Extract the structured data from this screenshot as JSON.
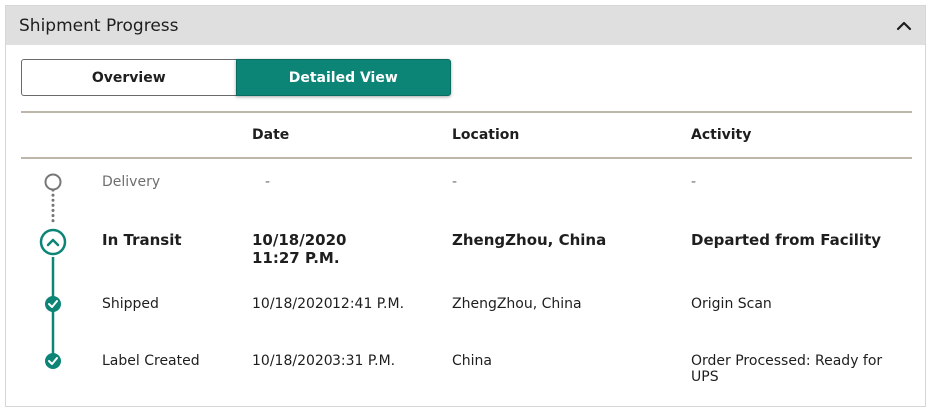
{
  "panel": {
    "title": "Shipment Progress",
    "collapse_icon": "chevron-up-icon"
  },
  "toggle": {
    "overview_label": "Overview",
    "detailed_label": "Detailed View",
    "active": "Detailed View",
    "active_color": "#0d8576"
  },
  "table": {
    "headers": {
      "date": "Date",
      "location": "Location",
      "activity": "Activity"
    },
    "rows": [
      {
        "status": "Delivery",
        "date": "-",
        "time": "",
        "location": "-",
        "activity": "-",
        "state": "pending"
      },
      {
        "status": "In Transit",
        "date": "10/18/2020",
        "time": "11:27 P.M.",
        "location": "ZhengZhou, China",
        "activity": "Departed from Facility",
        "state": "current"
      },
      {
        "status": "Shipped",
        "date": "10/18/2020",
        "time": "12:41 P.M.",
        "location": "ZhengZhou, China",
        "activity": "Origin Scan",
        "state": "done"
      },
      {
        "status": "Label Created",
        "date": "10/18/2020",
        "time": "3:31 P.M.",
        "location": "China",
        "activity": "Order Processed: Ready for UPS",
        "state": "done"
      }
    ]
  },
  "colors": {
    "accent": "#0d8576",
    "pending": "#777777",
    "rule": "#bfb6ab"
  }
}
